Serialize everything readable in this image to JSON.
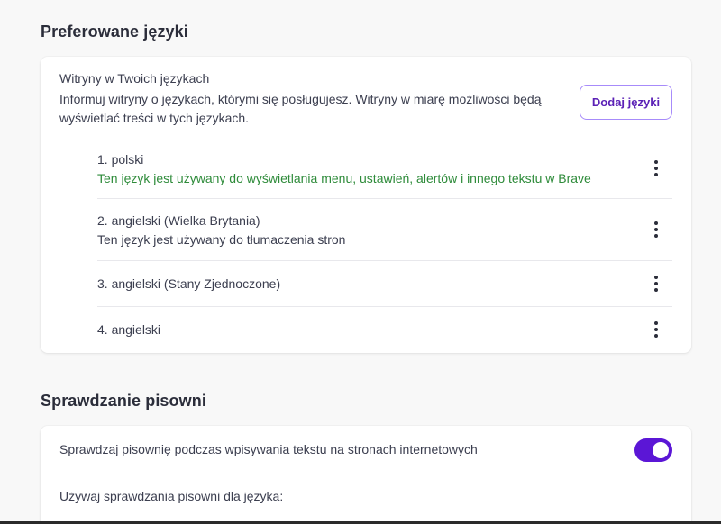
{
  "languages_section": {
    "title": "Preferowane języki",
    "intro_title": "Witryny w Twoich językach",
    "intro_desc": "Informuj witryny o językach, którymi się posługujesz. Witryny w miarę możliwości będą wyświetlać treści w tych językach.",
    "add_button": "Dodaj języki",
    "items": [
      {
        "name": "1. polski",
        "note": "Ten język jest używany do wyświetlania menu, ustawień, alertów i innego tekstu w Brave",
        "note_color": "#2e8b3a"
      },
      {
        "name": "2. angielski (Wielka Brytania)",
        "note": "Ten język jest używany do tłumaczenia stron",
        "note_color": "#3b3e4f"
      },
      {
        "name": "3. angielski (Stany Zjednoczone)",
        "note": ""
      },
      {
        "name": "4. angielski",
        "note": ""
      }
    ]
  },
  "spellcheck_section": {
    "title": "Sprawdzanie pisowni",
    "toggle_label": "Sprawdzaj pisownię podczas wpisywania tekstu na stronach internetowych",
    "toggle_on": true,
    "toggle_color": "#5b16d6",
    "language_label": "Używaj sprawdzania pisowni dla języka:"
  },
  "colors": {
    "accent": "#5b21b6",
    "background": "#f8f8f8"
  }
}
